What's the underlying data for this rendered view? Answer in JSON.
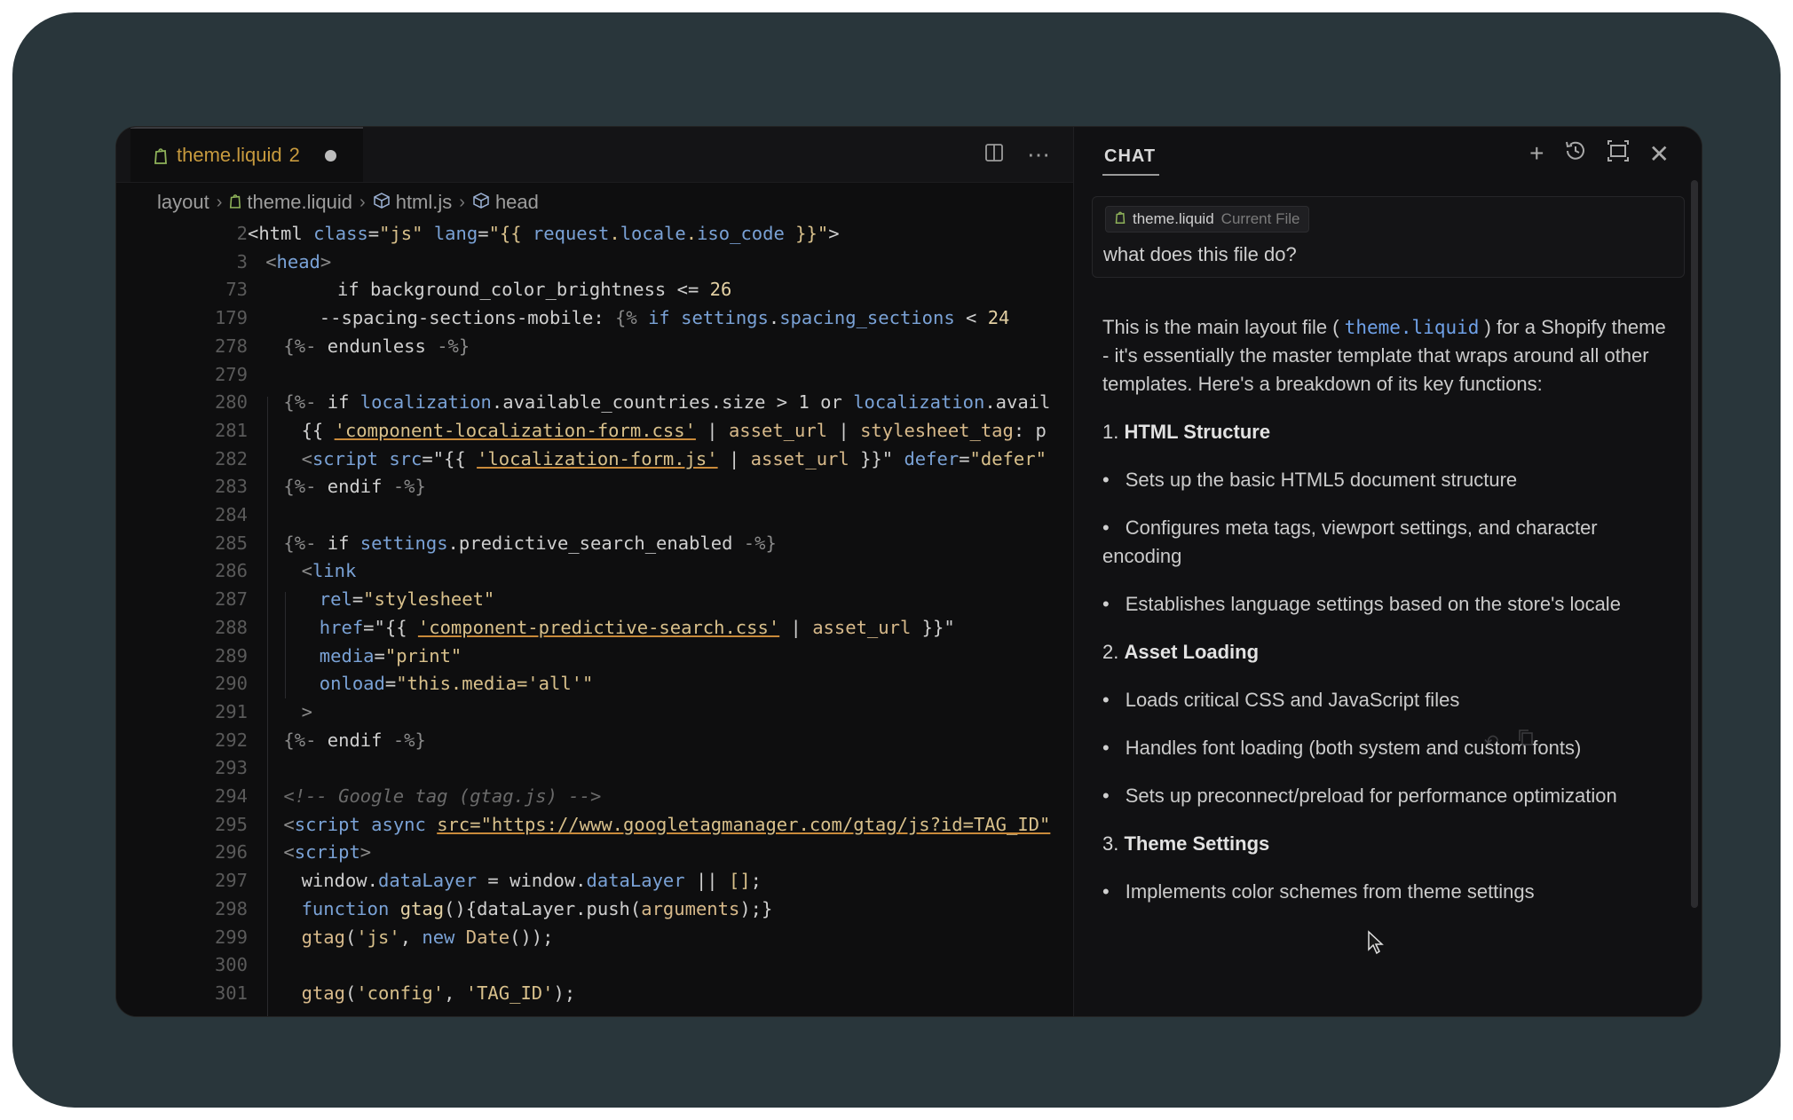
{
  "editor": {
    "tab": {
      "filename": "theme.liquid",
      "problems": "2"
    },
    "breadcrumb": [
      "layout",
      "theme.liquid",
      "html.js",
      "head"
    ],
    "lines": [
      {
        "n": "2",
        "indent": 0,
        "segs": [
          [
            "t",
            "<html "
          ],
          [
            "k",
            "class"
          ],
          [
            "t",
            "="
          ],
          [
            "s",
            "\"js\""
          ],
          [
            "t",
            " "
          ],
          [
            "k",
            "lang"
          ],
          [
            "t",
            "="
          ],
          [
            "s",
            "\"{{ "
          ],
          [
            "k",
            "request"
          ],
          [
            "s",
            "."
          ],
          [
            "k",
            "locale"
          ],
          [
            "s",
            "."
          ],
          [
            "k",
            "iso_code"
          ],
          [
            "s",
            " }}\""
          ],
          [
            "t",
            ">"
          ]
        ]
      },
      {
        "n": "3",
        "indent": 1,
        "segs": [
          [
            "g",
            "<"
          ],
          [
            "k",
            "head"
          ],
          [
            "g",
            ">"
          ]
        ]
      },
      {
        "n": "73",
        "indent": 5,
        "segs": [
          [
            "t",
            "if background_color_brightness <= "
          ],
          [
            "n",
            "26"
          ]
        ]
      },
      {
        "n": "179",
        "indent": 4,
        "segs": [
          [
            "t",
            "--spacing-sections-mobile: "
          ],
          [
            "g",
            "{% "
          ],
          [
            "k",
            "if settings"
          ],
          [
            "t",
            "."
          ],
          [
            "k",
            "spacing_sections"
          ],
          [
            "t",
            " < "
          ],
          [
            "n",
            "24"
          ]
        ]
      },
      {
        "n": "278",
        "indent": 2,
        "segs": [
          [
            "g",
            "{%- "
          ],
          [
            "t",
            "endunless "
          ],
          [
            "g",
            "-%}"
          ]
        ]
      },
      {
        "n": "279",
        "indent": 0,
        "segs": []
      },
      {
        "n": "280",
        "indent": 2,
        "segs": [
          [
            "g",
            "{%- "
          ],
          [
            "t",
            "if "
          ],
          [
            "k",
            "localization"
          ],
          [
            "t",
            ".available_countries.size > 1 or "
          ],
          [
            "k",
            "localization"
          ],
          [
            "t",
            ".avail"
          ]
        ]
      },
      {
        "n": "281",
        "indent": 3,
        "segs": [
          [
            "t",
            "{{ "
          ],
          [
            "su",
            "'component-localization-form.css'"
          ],
          [
            "t",
            " | "
          ],
          [
            "f",
            "asset_url"
          ],
          [
            "t",
            " | "
          ],
          [
            "f",
            "stylesheet_tag"
          ],
          [
            "t",
            ": p"
          ]
        ]
      },
      {
        "n": "282",
        "indent": 3,
        "segs": [
          [
            "g",
            "<"
          ],
          [
            "k",
            "script"
          ],
          [
            "t",
            " "
          ],
          [
            "k",
            "src"
          ],
          [
            "t",
            "=\"{{ "
          ],
          [
            "su",
            "'localization-form.js'"
          ],
          [
            "t",
            " | "
          ],
          [
            "f",
            "asset_url"
          ],
          [
            "t",
            " }}\" "
          ],
          [
            "k",
            "defer"
          ],
          [
            "t",
            "="
          ],
          [
            "s",
            "\"defer\""
          ]
        ]
      },
      {
        "n": "283",
        "indent": 2,
        "segs": [
          [
            "g",
            "{%- "
          ],
          [
            "t",
            "endif "
          ],
          [
            "g",
            "-%}"
          ]
        ]
      },
      {
        "n": "284",
        "indent": 0,
        "segs": []
      },
      {
        "n": "285",
        "indent": 2,
        "segs": [
          [
            "g",
            "{%- "
          ],
          [
            "t",
            "if "
          ],
          [
            "k",
            "settings"
          ],
          [
            "t",
            ".predictive_search_enabled "
          ],
          [
            "g",
            "-%}"
          ]
        ]
      },
      {
        "n": "286",
        "indent": 3,
        "segs": [
          [
            "g",
            "<"
          ],
          [
            "k",
            "link"
          ]
        ]
      },
      {
        "n": "287",
        "indent": 4,
        "segs": [
          [
            "k",
            "rel"
          ],
          [
            "t",
            "="
          ],
          [
            "s",
            "\"stylesheet\""
          ]
        ]
      },
      {
        "n": "288",
        "indent": 4,
        "segs": [
          [
            "k",
            "href"
          ],
          [
            "t",
            "=\"{{ "
          ],
          [
            "su",
            "'component-predictive-search.css'"
          ],
          [
            "t",
            " | "
          ],
          [
            "f",
            "asset_url"
          ],
          [
            "t",
            " }}\""
          ]
        ]
      },
      {
        "n": "289",
        "indent": 4,
        "segs": [
          [
            "k",
            "media"
          ],
          [
            "t",
            "="
          ],
          [
            "s",
            "\"print\""
          ]
        ]
      },
      {
        "n": "290",
        "indent": 4,
        "segs": [
          [
            "k",
            "onload"
          ],
          [
            "t",
            "="
          ],
          [
            "s",
            "\"this.media='all'\""
          ]
        ]
      },
      {
        "n": "291",
        "indent": 3,
        "segs": [
          [
            "g",
            ">"
          ]
        ]
      },
      {
        "n": "292",
        "indent": 2,
        "segs": [
          [
            "g",
            "{%- "
          ],
          [
            "t",
            "endif "
          ],
          [
            "g",
            "-%}"
          ]
        ]
      },
      {
        "n": "293",
        "indent": 0,
        "segs": []
      },
      {
        "n": "294",
        "indent": 2,
        "segs": [
          [
            "c",
            "<!-- Google tag (gtag.js) -->"
          ]
        ]
      },
      {
        "n": "295",
        "indent": 2,
        "segs": [
          [
            "g",
            "<"
          ],
          [
            "k",
            "script"
          ],
          [
            "t",
            " "
          ],
          [
            "k",
            "async"
          ],
          [
            "t",
            " "
          ],
          [
            "su",
            "src=\"https://www.googletagmanager.com/gtag/js?id=TAG_ID\""
          ]
        ]
      },
      {
        "n": "296",
        "indent": 2,
        "segs": [
          [
            "g",
            "<"
          ],
          [
            "k",
            "script"
          ],
          [
            "g",
            ">"
          ]
        ]
      },
      {
        "n": "297",
        "indent": 3,
        "segs": [
          [
            "t",
            "window."
          ],
          [
            "k",
            "dataLayer"
          ],
          [
            "t",
            " = window."
          ],
          [
            "k",
            "dataLayer"
          ],
          [
            "t",
            " || "
          ],
          [
            "s",
            "[]"
          ],
          [
            "t",
            ";"
          ]
        ]
      },
      {
        "n": "298",
        "indent": 3,
        "segs": [
          [
            "k",
            "function "
          ],
          [
            "n",
            "gtag"
          ],
          [
            "t",
            "(){dataLayer.push("
          ],
          [
            "f",
            "arguments"
          ],
          [
            "t",
            ");}"
          ]
        ]
      },
      {
        "n": "299",
        "indent": 3,
        "segs": [
          [
            "f",
            "gtag"
          ],
          [
            "t",
            "("
          ],
          [
            "s",
            "'js'"
          ],
          [
            "t",
            ", "
          ],
          [
            "k",
            "new "
          ],
          [
            "f",
            "Date"
          ],
          [
            "t",
            "());"
          ]
        ]
      },
      {
        "n": "300",
        "indent": 0,
        "segs": []
      },
      {
        "n": "301",
        "indent": 3,
        "segs": [
          [
            "f",
            "gtag"
          ],
          [
            "t",
            "("
          ],
          [
            "s",
            "'config'"
          ],
          [
            "t",
            ", "
          ],
          [
            "s",
            "'TAG_ID'"
          ],
          [
            "t",
            ");"
          ]
        ]
      }
    ]
  },
  "chat": {
    "title": "CHAT",
    "context_file": "theme.liquid",
    "context_tag": "Current File",
    "question": "what does this file do?",
    "intro_a": "This is the main layout file (",
    "intro_code": "theme.liquid",
    "intro_b": ") for a Shopify theme - it's essentially the master template that wraps around all other templates. Here's a breakdown of its key functions:",
    "sections": [
      {
        "num": "1.",
        "title": "HTML Structure",
        "items": [
          "Sets up the basic HTML5 document structure",
          "Configures meta tags, viewport settings, and character encoding",
          "Establishes language settings based on the store's locale"
        ]
      },
      {
        "num": "2.",
        "title": "Asset Loading",
        "items": [
          "Loads critical CSS and JavaScript files",
          "Handles font loading (both system and custom fonts)",
          "Sets up preconnect/preload for performance optimization"
        ]
      },
      {
        "num": "3.",
        "title": "Theme Settings",
        "items": [
          "Implements color schemes from theme settings"
        ]
      }
    ]
  }
}
